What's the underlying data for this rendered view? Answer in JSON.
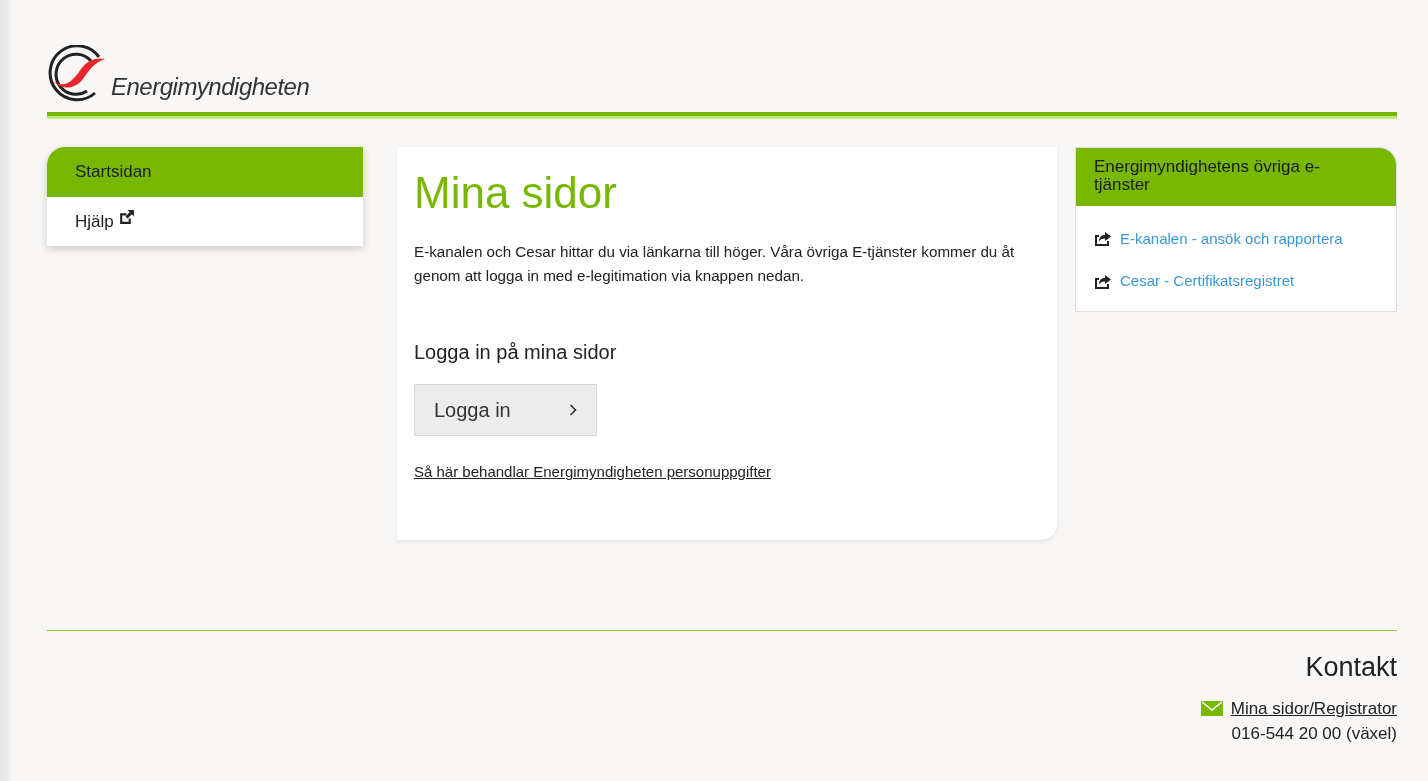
{
  "logo": {
    "text": "Energimyndigheten"
  },
  "sidebar": {
    "items": [
      {
        "label": "Startsidan",
        "selected": true,
        "external": false
      },
      {
        "label": "Hjälp",
        "selected": false,
        "external": true
      }
    ]
  },
  "main": {
    "title": "Mina sidor",
    "intro": "E-kanalen och Cesar hittar du via länkarna till höger. Våra övriga E-tjänster kommer du åt genom att logga in med e-legitimation via knappen nedan.",
    "login_heading": "Logga in på mina sidor",
    "login_button": "Logga in",
    "privacy_link": "Så här behandlar Energimyndigheten personuppgifter"
  },
  "services": {
    "title": "Energimyndighetens övriga e-tjänster",
    "links": [
      "E-kanalen - ansök och rapportera",
      "Cesar - Certifikatsregistret"
    ]
  },
  "footer": {
    "heading": "Kontakt",
    "email_link": "Mina sidor/Registrator",
    "phone": "016-544 20 00 (växel)"
  }
}
